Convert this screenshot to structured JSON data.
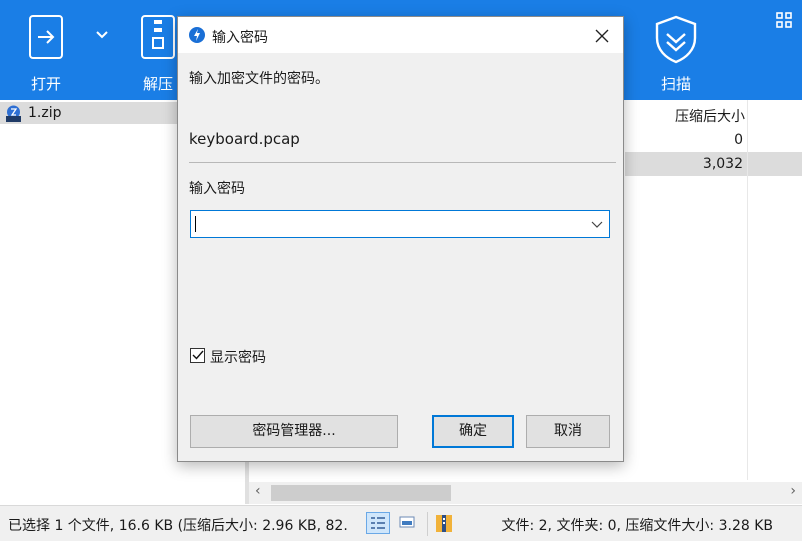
{
  "toolbar": {
    "open_label": "打开",
    "extract_label": "解压",
    "scan_label": "扫描"
  },
  "tree": {
    "items": [
      {
        "label": "1.zip"
      }
    ]
  },
  "file_list": {
    "column_header": "压缩后大小",
    "rows": [
      {
        "compressed_size": "0"
      },
      {
        "compressed_size": "3,032"
      }
    ]
  },
  "dialog": {
    "title": "输入密码",
    "prompt": "输入加密文件的密码。",
    "file_name": "keyboard.pcap",
    "password_label": "输入密码",
    "password_value": "",
    "show_password_label": "显示密码",
    "show_password_checked": true,
    "password_manager_button": "密码管理器...",
    "ok_button": "确定",
    "cancel_button": "取消"
  },
  "status_bar": {
    "selection_text": "已选择 1 个文件, 16.6 KB (压缩后大小: 2.96 KB, 82.",
    "summary_text": "文件: 2, 文件夹: 0, 压缩文件大小: 3.28 KB"
  },
  "colors": {
    "toolbar_bg": "#1a7ee6",
    "accent": "#0078d7"
  }
}
